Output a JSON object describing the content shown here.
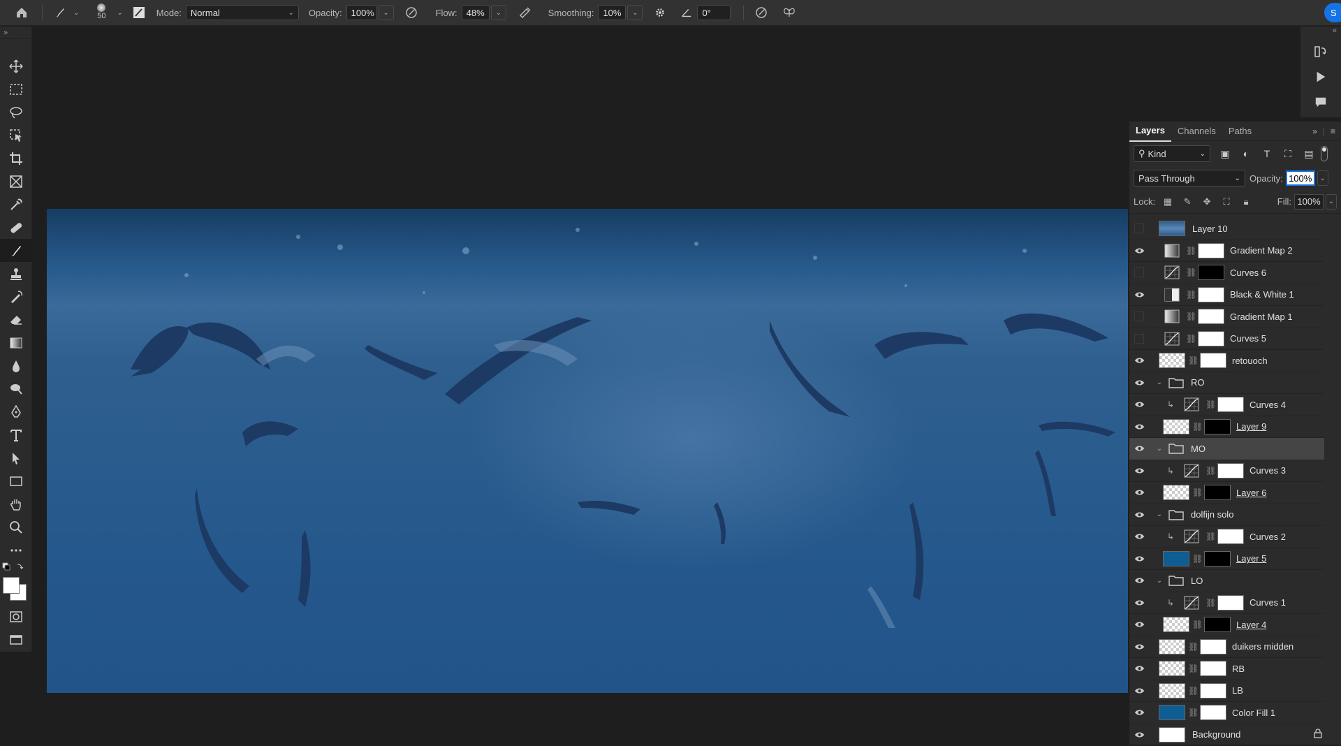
{
  "options_bar": {
    "brush_size": "50",
    "mode_label": "Mode:",
    "mode_value": "Normal",
    "opacity_label": "Opacity:",
    "opacity_value": "100%",
    "flow_label": "Flow:",
    "flow_value": "48%",
    "smoothing_label": "Smoothing:",
    "smoothing_value": "10%",
    "angle_value": "0°",
    "share_label": "S"
  },
  "tools": [
    "move-tool",
    "marquee-tool",
    "lasso-tool",
    "object-select-tool",
    "crop-tool",
    "frame-tool",
    "eyedropper-tool",
    "healing-tool",
    "brush-tool",
    "stamp-tool",
    "history-brush-tool",
    "eraser-tool",
    "gradient-tool",
    "blur-tool",
    "dodge-tool",
    "pen-tool",
    "type-tool",
    "path-select-tool",
    "rectangle-tool",
    "hand-tool",
    "zoom-tool",
    "more-tools"
  ],
  "active_tool": "brush-tool",
  "panel": {
    "tabs": [
      "Layers",
      "Channels",
      "Paths"
    ],
    "active_tab": "Layers",
    "filter_kind": "Kind",
    "blend_mode": "Pass Through",
    "opacity_label": "Opacity:",
    "opacity_value": "100%",
    "lock_label": "Lock:",
    "fill_label": "Fill:",
    "fill_value": "100%"
  },
  "layers": [
    {
      "name": "Layer 10",
      "visible": false,
      "type": "pixel",
      "indent": 0,
      "thumb": "photo"
    },
    {
      "name": "Gradient Map 2",
      "visible": true,
      "type": "adjustment",
      "adj": "gradient",
      "mask": "white",
      "indent": 0
    },
    {
      "name": "Curves 6",
      "visible": false,
      "type": "adjustment",
      "adj": "curves",
      "mask": "black",
      "indent": 0
    },
    {
      "name": "Black & White 1",
      "visible": true,
      "type": "adjustment",
      "adj": "bw",
      "mask": "white",
      "indent": 0
    },
    {
      "name": "Gradient Map 1",
      "visible": false,
      "type": "adjustment",
      "adj": "gradient",
      "mask": "white",
      "indent": 0
    },
    {
      "name": "Curves 5",
      "visible": false,
      "type": "adjustment",
      "adj": "curves",
      "mask": "white",
      "indent": 0
    },
    {
      "name": "retouoch",
      "visible": true,
      "type": "pixel",
      "thumb": "checker",
      "mask": "white",
      "indent": 0
    },
    {
      "name": "RO",
      "visible": true,
      "type": "group",
      "indent": 0
    },
    {
      "name": "Curves 4",
      "visible": true,
      "type": "adjustment",
      "adj": "curves",
      "mask": "white",
      "indent": 1,
      "clipped": true
    },
    {
      "name": "Layer 9",
      "visible": true,
      "type": "pixel",
      "thumb": "checker",
      "mask": "black",
      "indent": 1,
      "underline": true
    },
    {
      "name": "MO",
      "visible": true,
      "type": "group",
      "indent": 0,
      "selected": true
    },
    {
      "name": "Curves 3",
      "visible": true,
      "type": "adjustment",
      "adj": "curves",
      "mask": "white",
      "indent": 1,
      "clipped": true
    },
    {
      "name": "Layer 6",
      "visible": true,
      "type": "pixel",
      "thumb": "checker",
      "mask": "black",
      "indent": 1,
      "underline": true
    },
    {
      "name": "dolfijn solo",
      "visible": true,
      "type": "group",
      "indent": 0
    },
    {
      "name": "Curves 2",
      "visible": true,
      "type": "adjustment",
      "adj": "curves",
      "mask": "white",
      "indent": 1,
      "clipped": true
    },
    {
      "name": "Layer 5",
      "visible": true,
      "type": "pixel",
      "thumb": "blue",
      "mask": "black",
      "indent": 1,
      "underline": true
    },
    {
      "name": "LO",
      "visible": true,
      "type": "group",
      "indent": 0
    },
    {
      "name": "Curves 1",
      "visible": true,
      "type": "adjustment",
      "adj": "curves",
      "mask": "white",
      "indent": 1,
      "clipped": true
    },
    {
      "name": "Layer 4",
      "visible": true,
      "type": "pixel",
      "thumb": "checker",
      "mask": "black",
      "indent": 1,
      "underline": true
    },
    {
      "name": "duikers midden",
      "visible": true,
      "type": "pixel",
      "thumb": "checker",
      "mask": "white",
      "indent": 0
    },
    {
      "name": "RB",
      "visible": true,
      "type": "pixel",
      "thumb": "checker",
      "mask": "white",
      "indent": 0
    },
    {
      "name": "LB",
      "visible": true,
      "type": "pixel",
      "thumb": "checker",
      "mask": "white",
      "indent": 0
    },
    {
      "name": "Color Fill 1",
      "visible": true,
      "type": "fill",
      "thumb": "blue",
      "mask": "white",
      "indent": 0
    },
    {
      "name": "Background",
      "visible": true,
      "type": "background",
      "thumb": "white",
      "indent": 0,
      "locked": true
    }
  ],
  "colors": {
    "accent": "#1473e6",
    "fill_color": "#0e5d93"
  }
}
